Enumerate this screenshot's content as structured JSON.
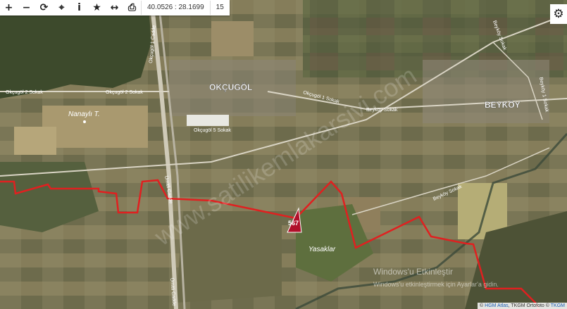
{
  "toolbar": {
    "tools": [
      {
        "name": "zoom-in-button",
        "glyph": "+"
      },
      {
        "name": "zoom-out-button",
        "glyph": "−"
      },
      {
        "name": "refresh-button",
        "glyph": "⟳"
      },
      {
        "name": "locate-button",
        "glyph": "⌖"
      },
      {
        "name": "info-button",
        "glyph": "i"
      },
      {
        "name": "favorite-button",
        "glyph": "★"
      },
      {
        "name": "measure-button",
        "glyph": "↔"
      },
      {
        "name": "print-button",
        "glyph": "⎙"
      }
    ],
    "coordinates": "40.0526 : 28.1699",
    "zoom": "15"
  },
  "settings_icon": "⚙",
  "labels": {
    "village1": "OKÇUGÖL",
    "village2": "BEYKÖY",
    "hill": "Nanaylı T.",
    "area": "Yasaklar",
    "parcel": "567",
    "road1": "Okçugöl 2 Sokak",
    "road2": "Okçugöl 5 Sokak",
    "road3": "Okçugöl 1 Sokak",
    "road4": "Okçugöl 1 Cadde",
    "road5": "Beyköy Sokak",
    "road6": "Beyköy Sokak",
    "road7": "Beyköy Sokak",
    "road8": "Beyköy 1 Sokak",
    "road9": "Ümitli Cadde",
    "road10": "Ümitli Cadde"
  },
  "watermark": {
    "text": "www.satilikemlakarsivi.com",
    "windows_title": "Windows'u Etkinleştir",
    "windows_sub": "Windows'u etkinleştirmek için Ayarlar'a gidin."
  },
  "attribution": {
    "prefix": "©",
    "atlas": "HGM Atlas",
    "sep": ", TKGM Ortofoto ©",
    "tkgm": "TKGM"
  },
  "colors": {
    "boundary": "#e02020",
    "parcel_fill": "#b0102a",
    "road": "#d9d4c4"
  }
}
